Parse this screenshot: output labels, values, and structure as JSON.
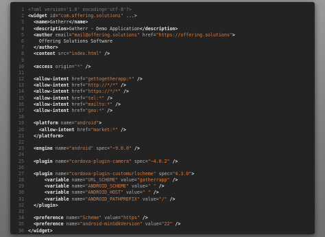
{
  "editor": {
    "lines": [
      {
        "n": "1",
        "parts": [
          {
            "t": "decl",
            "s": "<?xml version='1.0' encoding='utf-8'?>"
          }
        ]
      },
      {
        "n": "2",
        "parts": [
          {
            "t": "tag",
            "s": "<widget "
          },
          {
            "t": "attr",
            "s": "id="
          },
          {
            "t": "val",
            "s": "\"com.offering.solutions\""
          },
          {
            "t": "text",
            "s": " ...>"
          }
        ]
      },
      {
        "n": "3",
        "parts": [
          {
            "t": "text",
            "s": "  "
          },
          {
            "t": "tag",
            "s": "<name>"
          },
          {
            "t": "text",
            "s": "Gatherr"
          },
          {
            "t": "tag",
            "s": "</name>"
          }
        ]
      },
      {
        "n": "4",
        "parts": [
          {
            "t": "text",
            "s": "  "
          },
          {
            "t": "tag",
            "s": "<description>"
          },
          {
            "t": "text",
            "s": "Gatherr - Demo Application"
          },
          {
            "t": "tag",
            "s": "</description>"
          }
        ]
      },
      {
        "n": "5",
        "parts": [
          {
            "t": "text",
            "s": "  "
          },
          {
            "t": "tag",
            "s": "<author "
          },
          {
            "t": "attr",
            "s": "email="
          },
          {
            "t": "val",
            "s": "\"mail@offering.solutions\""
          },
          {
            "t": "attr",
            "s": " href="
          },
          {
            "t": "val",
            "s": "\"https://offering.solutions\""
          },
          {
            "t": "tag",
            "s": ">"
          }
        ]
      },
      {
        "n": "6",
        "parts": [
          {
            "t": "text",
            "s": "    Offering Solutions Software"
          }
        ]
      },
      {
        "n": "7",
        "parts": [
          {
            "t": "text",
            "s": "  "
          },
          {
            "t": "tag",
            "s": "</author>"
          }
        ]
      },
      {
        "n": "8",
        "parts": [
          {
            "t": "text",
            "s": "  "
          },
          {
            "t": "tag",
            "s": "<content "
          },
          {
            "t": "attr",
            "s": "src="
          },
          {
            "t": "val",
            "s": "\"index.html\""
          },
          {
            "t": "tag",
            "s": " />"
          }
        ]
      },
      {
        "n": "9",
        "parts": []
      },
      {
        "n": "10",
        "parts": [
          {
            "t": "text",
            "s": "  "
          },
          {
            "t": "tag",
            "s": "<access "
          },
          {
            "t": "attr",
            "s": "origin="
          },
          {
            "t": "val",
            "s": "\"*\""
          },
          {
            "t": "tag",
            "s": " />"
          }
        ]
      },
      {
        "n": "11",
        "parts": []
      },
      {
        "n": "12",
        "parts": [
          {
            "t": "text",
            "s": "  "
          },
          {
            "t": "tag",
            "s": "<allow-intent "
          },
          {
            "t": "attr",
            "s": "href="
          },
          {
            "t": "val",
            "s": "\"gettogetherapp:*\""
          },
          {
            "t": "tag",
            "s": " />"
          }
        ]
      },
      {
        "n": "13",
        "parts": [
          {
            "t": "text",
            "s": "  "
          },
          {
            "t": "tag",
            "s": "<allow-intent "
          },
          {
            "t": "attr",
            "s": "href="
          },
          {
            "t": "val",
            "s": "\"http://*/*\""
          },
          {
            "t": "tag",
            "s": " />"
          }
        ]
      },
      {
        "n": "14",
        "parts": [
          {
            "t": "text",
            "s": "  "
          },
          {
            "t": "tag",
            "s": "<allow-intent "
          },
          {
            "t": "attr",
            "s": "href="
          },
          {
            "t": "val",
            "s": "\"https://*/*\""
          },
          {
            "t": "tag",
            "s": " />"
          }
        ]
      },
      {
        "n": "15",
        "parts": [
          {
            "t": "text",
            "s": "  "
          },
          {
            "t": "tag",
            "s": "<allow-intent "
          },
          {
            "t": "attr",
            "s": "href="
          },
          {
            "t": "val",
            "s": "\"tel:*\""
          },
          {
            "t": "tag",
            "s": " />"
          }
        ]
      },
      {
        "n": "16",
        "parts": [
          {
            "t": "text",
            "s": "  "
          },
          {
            "t": "tag",
            "s": "<allow-intent "
          },
          {
            "t": "attr",
            "s": "href="
          },
          {
            "t": "val",
            "s": "\"mailto:*\""
          },
          {
            "t": "tag",
            "s": " />"
          }
        ]
      },
      {
        "n": "17",
        "parts": [
          {
            "t": "text",
            "s": "  "
          },
          {
            "t": "tag",
            "s": "<allow-intent "
          },
          {
            "t": "attr",
            "s": "href="
          },
          {
            "t": "val",
            "s": "\"geo:*\""
          },
          {
            "t": "tag",
            "s": " />"
          }
        ]
      },
      {
        "n": "18",
        "parts": []
      },
      {
        "n": "19",
        "parts": [
          {
            "t": "text",
            "s": "  "
          },
          {
            "t": "tag",
            "s": "<platform "
          },
          {
            "t": "attr",
            "s": "name="
          },
          {
            "t": "val",
            "s": "\"android\""
          },
          {
            "t": "tag",
            "s": ">"
          }
        ]
      },
      {
        "n": "20",
        "parts": [
          {
            "t": "text",
            "s": "    "
          },
          {
            "t": "tag",
            "s": "<allow-intent "
          },
          {
            "t": "attr",
            "s": "href="
          },
          {
            "t": "val",
            "s": "\"market:*\""
          },
          {
            "t": "tag",
            "s": " />"
          }
        ]
      },
      {
        "n": "21",
        "parts": [
          {
            "t": "text",
            "s": "  "
          },
          {
            "t": "tag",
            "s": "</platform>"
          }
        ]
      },
      {
        "n": "22",
        "parts": []
      },
      {
        "n": "23",
        "parts": [
          {
            "t": "text",
            "s": "  "
          },
          {
            "t": "tag",
            "s": "<engine "
          },
          {
            "t": "attr",
            "s": "name="
          },
          {
            "t": "val",
            "s": "\"android\""
          },
          {
            "t": "attr",
            "s": " spec="
          },
          {
            "t": "val",
            "s": "\"~9.0.0\""
          },
          {
            "t": "tag",
            "s": " />"
          }
        ]
      },
      {
        "n": "24",
        "parts": []
      },
      {
        "n": "25",
        "parts": [
          {
            "t": "text",
            "s": "  "
          },
          {
            "t": "tag",
            "s": "<plugin "
          },
          {
            "t": "attr",
            "s": "name="
          },
          {
            "t": "val",
            "s": "\"cordova-plugin-camera\""
          },
          {
            "t": "attr",
            "s": " spec="
          },
          {
            "t": "val",
            "s": "\"~4.0.2\""
          },
          {
            "t": "tag",
            "s": " />"
          }
        ]
      },
      {
        "n": "26",
        "parts": []
      },
      {
        "n": "27",
        "parts": [
          {
            "t": "text",
            "s": "  "
          },
          {
            "t": "tag",
            "s": "<plugin "
          },
          {
            "t": "attr",
            "s": "name="
          },
          {
            "t": "val",
            "s": "\"cordova-plugin-customurlscheme\""
          },
          {
            "t": "attr",
            "s": " spec="
          },
          {
            "t": "val",
            "s": "\"4.3.0\""
          },
          {
            "t": "tag",
            "s": ">"
          }
        ]
      },
      {
        "n": "28",
        "parts": [
          {
            "t": "text",
            "s": "      "
          },
          {
            "t": "tag",
            "s": "<variable "
          },
          {
            "t": "attr",
            "s": "name="
          },
          {
            "t": "val",
            "s": "\"URL_SCHEME\""
          },
          {
            "t": "attr",
            "s": " value="
          },
          {
            "t": "val",
            "s": "\"gatherrapp\""
          },
          {
            "t": "tag",
            "s": " />"
          }
        ]
      },
      {
        "n": "29",
        "parts": [
          {
            "t": "text",
            "s": "      "
          },
          {
            "t": "tag",
            "s": "<variable "
          },
          {
            "t": "attr",
            "s": "name="
          },
          {
            "t": "val",
            "s": "\"ANDROID_SCHEME\""
          },
          {
            "t": "attr",
            "s": " value="
          },
          {
            "t": "val",
            "s": "\" \""
          },
          {
            "t": "tag",
            "s": " />"
          }
        ]
      },
      {
        "n": "30",
        "parts": [
          {
            "t": "text",
            "s": "      "
          },
          {
            "t": "tag",
            "s": "<variable "
          },
          {
            "t": "attr",
            "s": "name="
          },
          {
            "t": "val",
            "s": "\"ANDROID_HOST\""
          },
          {
            "t": "attr",
            "s": " value="
          },
          {
            "t": "val",
            "s": "\" \""
          },
          {
            "t": "tag",
            "s": " />"
          }
        ]
      },
      {
        "n": "31",
        "parts": [
          {
            "t": "text",
            "s": "      "
          },
          {
            "t": "tag",
            "s": "<variable "
          },
          {
            "t": "attr",
            "s": "name="
          },
          {
            "t": "val",
            "s": "\"ANDROID_PATHPREFIX\""
          },
          {
            "t": "attr",
            "s": " value="
          },
          {
            "t": "val",
            "s": "\"/\""
          },
          {
            "t": "tag",
            "s": " />"
          }
        ]
      },
      {
        "n": "32",
        "parts": [
          {
            "t": "text",
            "s": "  "
          },
          {
            "t": "tag",
            "s": "</plugin>"
          }
        ]
      },
      {
        "n": "33",
        "parts": []
      },
      {
        "n": "34",
        "parts": [
          {
            "t": "text",
            "s": "  "
          },
          {
            "t": "tag",
            "s": "<preference "
          },
          {
            "t": "attr",
            "s": "name="
          },
          {
            "t": "val",
            "s": "\"Scheme\""
          },
          {
            "t": "attr",
            "s": " value="
          },
          {
            "t": "val",
            "s": "\"https\""
          },
          {
            "t": "tag",
            "s": " />"
          }
        ]
      },
      {
        "n": "35",
        "parts": [
          {
            "t": "text",
            "s": "  "
          },
          {
            "t": "tag",
            "s": "<preference "
          },
          {
            "t": "attr",
            "s": "name="
          },
          {
            "t": "val",
            "s": "\"android-minSdkVersion\""
          },
          {
            "t": "attr",
            "s": " value="
          },
          {
            "t": "val",
            "s": "\"22\""
          },
          {
            "t": "tag",
            "s": " />"
          }
        ]
      },
      {
        "n": "36",
        "parts": [
          {
            "t": "tag",
            "s": "</widget>"
          }
        ]
      }
    ]
  }
}
